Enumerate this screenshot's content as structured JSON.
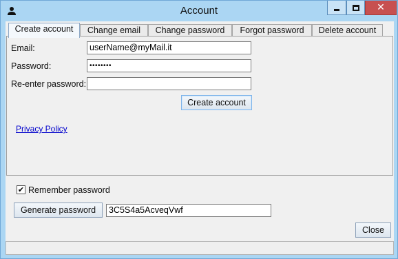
{
  "window": {
    "title": "Account",
    "icon": "person-icon",
    "controls": [
      "minimize-icon",
      "maximize-icon",
      "close-icon"
    ],
    "close_glyph": "✕"
  },
  "tabs": [
    {
      "label": "Create account",
      "active": true
    },
    {
      "label": "Change email",
      "active": false
    },
    {
      "label": "Change password",
      "active": false
    },
    {
      "label": "Forgot password",
      "active": false
    },
    {
      "label": "Delete account",
      "active": false
    }
  ],
  "form": {
    "email_label": "Email:",
    "email_value": "userName@myMail.it",
    "password_label": "Password:",
    "password_value": "••••••••",
    "reenter_label": "Re-enter password:",
    "reenter_value": "",
    "submit_label": "Create account",
    "privacy_link": "Privacy Policy"
  },
  "remember": {
    "label": "Remember password",
    "checked": true,
    "check_glyph": "✔"
  },
  "generator": {
    "button_label": "Generate password",
    "value": "3C5S4a5AcveqVwf"
  },
  "footer": {
    "close_label": "Close",
    "status_text": ""
  },
  "colors": {
    "frame": "#abd6f3",
    "close_button": "#c75050",
    "link": "#0000cc",
    "background": "#f0f0f0"
  }
}
